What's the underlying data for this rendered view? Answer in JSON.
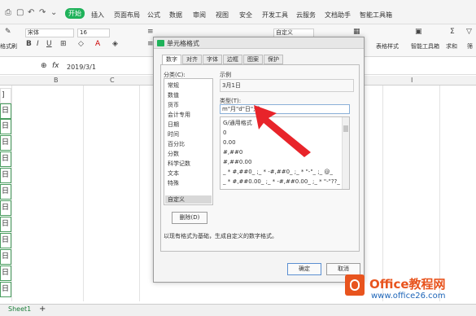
{
  "menubar": {
    "start_label": "开始",
    "items": [
      "插入",
      "页面布局",
      "公式",
      "数据",
      "审阅",
      "视图",
      "安全",
      "开发工具",
      "云服务",
      "文档助手",
      "智能工具箱"
    ]
  },
  "ribbon": {
    "font_name": "宋体",
    "font_size": "16",
    "format_value": "自定义",
    "left_label": "格式刷",
    "table_style_label": "表格样式",
    "smart_toolbox_label": "智能工具箱",
    "sum_label": "求和",
    "filter_label": "筛"
  },
  "formulabar": {
    "fx": "fx",
    "value": "2019/3/1"
  },
  "grid": {
    "columns": [
      "B",
      "C",
      "I"
    ],
    "row_glyph": "日"
  },
  "sheetbar": {
    "sheet_tab": "Sheet1"
  },
  "dialog": {
    "title": "单元格格式",
    "tabs": [
      "数字",
      "对齐",
      "字体",
      "边框",
      "图案",
      "保护"
    ],
    "category_label": "分类(C):",
    "categories": [
      "常规",
      "数值",
      "货币",
      "会计专用",
      "日期",
      "时间",
      "百分比",
      "分数",
      "科学记数",
      "文本",
      "特殊",
      "自定义"
    ],
    "selected_category": "自定义",
    "sample_label": "示例",
    "sample_value": "3月1日",
    "type_label": "类型(T):",
    "type_value": "m\"月\"d\"日\";@",
    "formats": [
      "G/通用格式",
      "0",
      "0.00",
      "#,##0",
      "#,##0.00",
      "_ * #,##0_ ;_ * -#,##0_ ;_ * \"-\"_ ;_ @_",
      "_ * #,##0.00_ ;_ * -#,##0.00_ ;_ * \"-\"??_ ;_ @_"
    ],
    "delete_label": "删除(D)",
    "description": "以现有格式为基础，生成自定义的数字格式。",
    "ok_label": "确定",
    "cancel_label": "取消"
  },
  "watermark": {
    "name": "Office教程网",
    "url": "www.office26.com"
  },
  "colors": {
    "accent_green": "#1fb25a",
    "arrow_red": "#e8242a",
    "watermark_orange": "#e8541e"
  }
}
